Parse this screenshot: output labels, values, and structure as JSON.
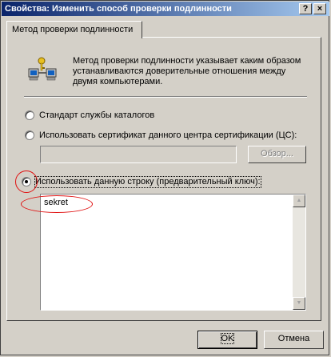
{
  "window": {
    "title": "Свойства: Изменить способ проверки подлинности",
    "help_glyph": "?",
    "close_glyph": "×"
  },
  "tab": {
    "label": "Метод проверки подлинности"
  },
  "description": "Метод проверки подлинности указывает каким образом\nустанавливаются доверительные отношения между\nдвумя компьютерами.",
  "icons": {
    "network": "network-computers-icon"
  },
  "options": {
    "directory": {
      "label": "Стандарт службы каталогов",
      "checked": false
    },
    "certificate": {
      "label": "Использовать сертификат данного центра сертификации (ЦС):",
      "checked": false,
      "value": "",
      "browse_label": "Обзор..."
    },
    "preshared": {
      "label": "Использовать данную строку (предварительный ключ):",
      "checked": true,
      "value": "sekret"
    }
  },
  "buttons": {
    "ok": "OK",
    "cancel": "Отмена"
  },
  "colors": {
    "highlight_ring": "#e01010",
    "title_start": "#0a246a"
  }
}
